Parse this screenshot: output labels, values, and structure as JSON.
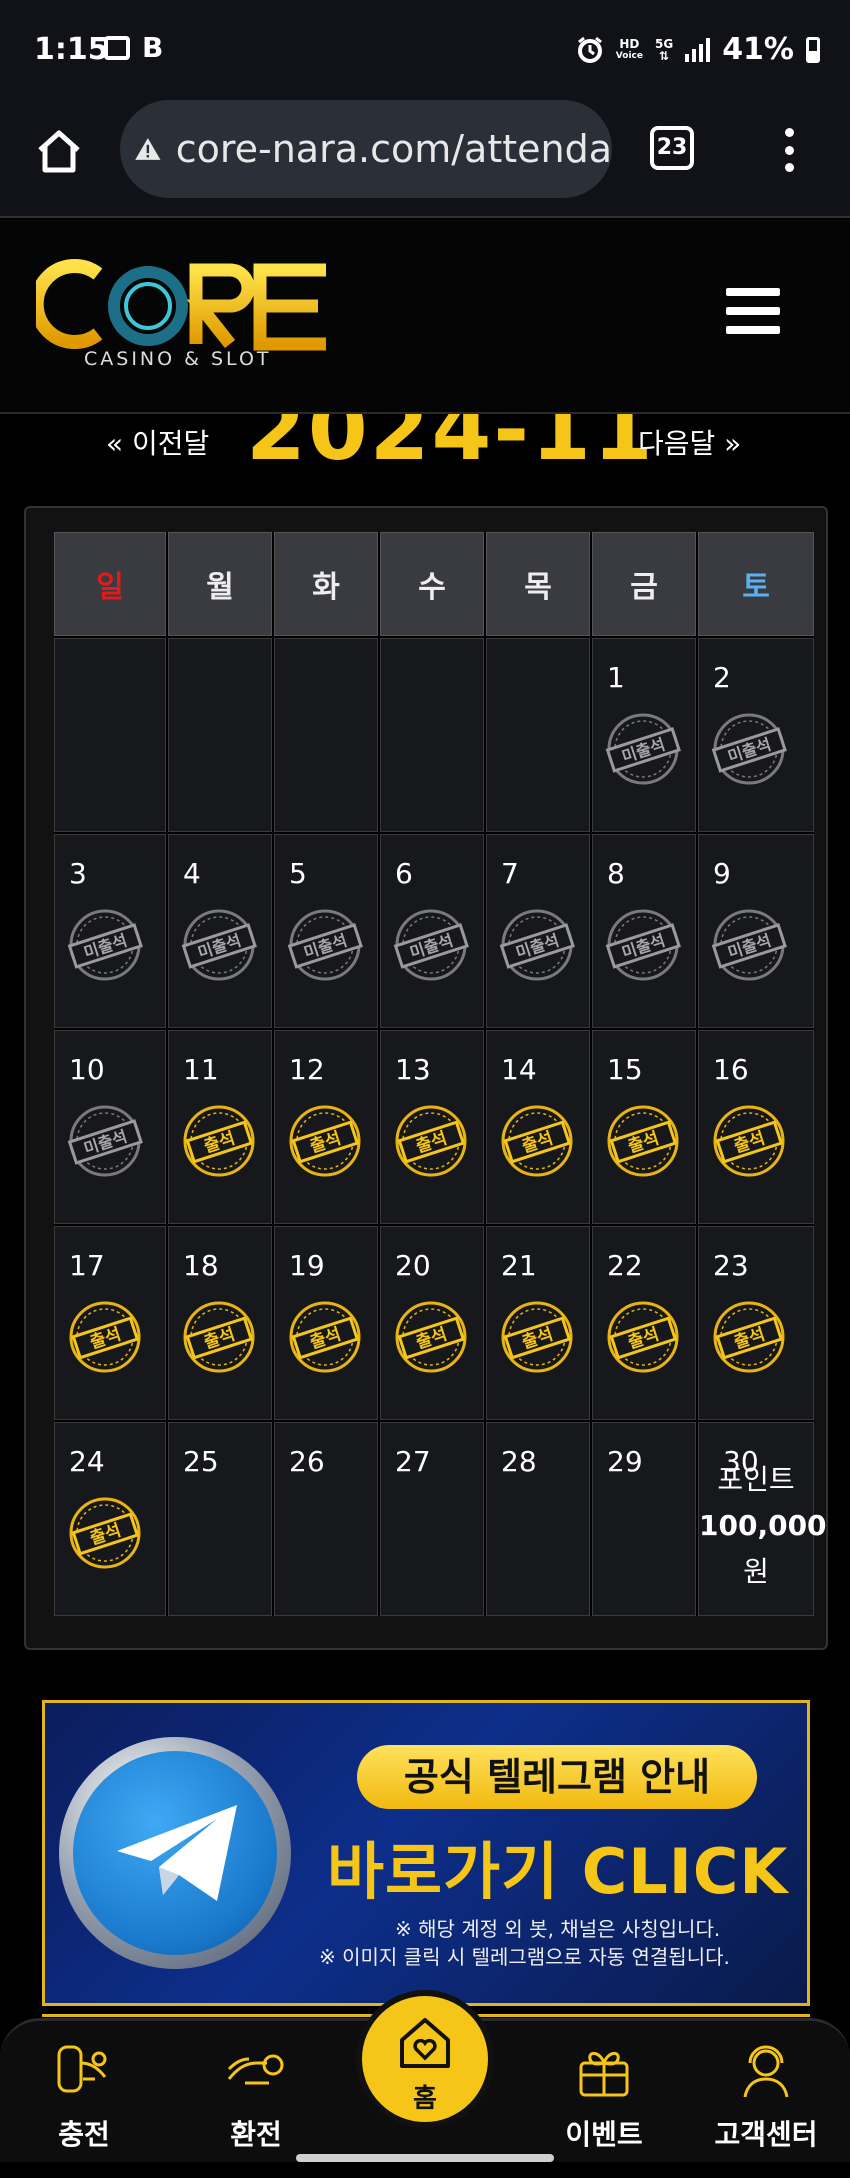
{
  "status_bar": {
    "time": "1:15",
    "network_hd": "HD",
    "network_voice": "Voice",
    "network_5g": "5G",
    "battery": "41%"
  },
  "browser": {
    "url": "core-nara.com/attenda",
    "tab_count": "23"
  },
  "site": {
    "logo_text": "CORE",
    "logo_sub": "CASINO & SLOT"
  },
  "calendar": {
    "prev_label": "« 이전달",
    "next_label": "다음달 »",
    "month_title": "2024-11",
    "weekdays": [
      "일",
      "월",
      "화",
      "수",
      "목",
      "금",
      "토"
    ],
    "stamp_absent": "미출석",
    "stamp_present": "출석",
    "days": [
      {
        "day": "",
        "status": ""
      },
      {
        "day": "",
        "status": ""
      },
      {
        "day": "",
        "status": ""
      },
      {
        "day": "",
        "status": ""
      },
      {
        "day": "",
        "status": ""
      },
      {
        "day": "1",
        "status": "absent"
      },
      {
        "day": "2",
        "status": "absent"
      },
      {
        "day": "3",
        "status": "absent"
      },
      {
        "day": "4",
        "status": "absent"
      },
      {
        "day": "5",
        "status": "absent"
      },
      {
        "day": "6",
        "status": "absent"
      },
      {
        "day": "7",
        "status": "absent"
      },
      {
        "day": "8",
        "status": "absent"
      },
      {
        "day": "9",
        "status": "absent"
      },
      {
        "day": "10",
        "status": "absent"
      },
      {
        "day": "11",
        "status": "present"
      },
      {
        "day": "12",
        "status": "present"
      },
      {
        "day": "13",
        "status": "present"
      },
      {
        "day": "14",
        "status": "present"
      },
      {
        "day": "15",
        "status": "present"
      },
      {
        "day": "16",
        "status": "present"
      },
      {
        "day": "17",
        "status": "present"
      },
      {
        "day": "18",
        "status": "present"
      },
      {
        "day": "19",
        "status": "present"
      },
      {
        "day": "20",
        "status": "present"
      },
      {
        "day": "21",
        "status": "present"
      },
      {
        "day": "22",
        "status": "present"
      },
      {
        "day": "23",
        "status": "present"
      },
      {
        "day": "24",
        "status": "present"
      },
      {
        "day": "25",
        "status": ""
      },
      {
        "day": "26",
        "status": ""
      },
      {
        "day": "27",
        "status": ""
      },
      {
        "day": "28",
        "status": ""
      },
      {
        "day": "29",
        "status": ""
      },
      {
        "day": "30",
        "status": "point"
      }
    ],
    "point_line1": "포인트",
    "point_line2": "100,000",
    "point_line3": "원"
  },
  "banner": {
    "pill": "공식 텔레그램 안내",
    "main": "바로가기 CLICK",
    "note1": "※ 해당 계정 외 봇, 채널은 사칭입니다.",
    "note2": "※ 이미지 클릭 시 텔레그램으로 자동 연결됩니다."
  },
  "bottom_nav": {
    "deposit": "충전",
    "withdraw": "환전",
    "home": "홈",
    "event": "이벤트",
    "support": "고객센터"
  },
  "colors": {
    "accent_gold": "#f5c518",
    "sunday_red": "#e21a1a",
    "saturday_blue": "#5ab0f0",
    "background": "#000000"
  }
}
